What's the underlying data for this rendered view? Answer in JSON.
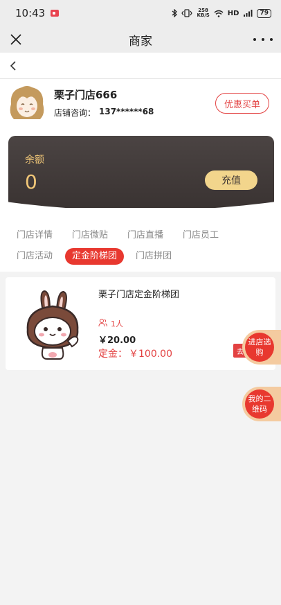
{
  "status_bar": {
    "time": "10:43",
    "net_speed_value": "258",
    "net_speed_unit": "KB/S",
    "network": "HD",
    "battery": "79"
  },
  "nav": {
    "title": "商家"
  },
  "shop": {
    "name": "栗子门店666",
    "phone_label": "店铺咨询：",
    "phone": "137******68",
    "discount_button": "优惠买单"
  },
  "balance": {
    "label": "余额",
    "value": "0",
    "recharge_button": "充值"
  },
  "tabs": {
    "items": [
      {
        "label": "门店详情",
        "active": false
      },
      {
        "label": "门店微贴",
        "active": false
      },
      {
        "label": "门店直播",
        "active": false
      },
      {
        "label": "门店员工",
        "active": false
      },
      {
        "label": "门店活动",
        "active": false
      },
      {
        "label": "定金阶梯团",
        "active": true
      },
      {
        "label": "门店拼团",
        "active": false
      }
    ]
  },
  "product": {
    "title": "栗子门店定金阶梯团",
    "people_count": "1人",
    "price": "￥20.00",
    "deposit_label": "定金：",
    "deposit_value": "￥100.00",
    "go_button": "去"
  },
  "floating": {
    "enter_store_button": "进店选购",
    "my_qr_button": "我的二维码"
  },
  "colors": {
    "accent": "#e8382f",
    "gold": "#f1c778",
    "card_dark": "#3f3837"
  }
}
